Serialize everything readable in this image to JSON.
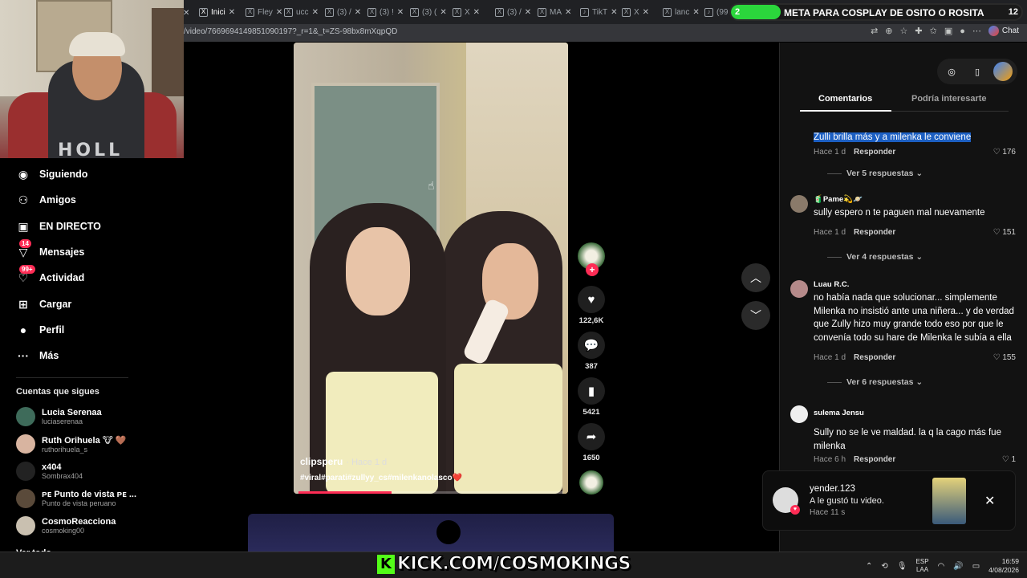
{
  "browser": {
    "tabs": [
      {
        "label": "Inici",
        "icon": "x-logo-icon",
        "active": true
      },
      {
        "label": "Fley",
        "icon": "x-logo-icon"
      },
      {
        "label": "ucc",
        "icon": "x-logo-icon"
      },
      {
        "label": "(3) /",
        "icon": "x-logo-icon"
      },
      {
        "label": "(3) !",
        "icon": "x-logo-icon"
      },
      {
        "label": "(3) (",
        "icon": "x-logo-icon"
      },
      {
        "label": "X",
        "icon": "x-logo-icon"
      },
      {
        "label": "(3) /",
        "icon": "x-logo-icon"
      },
      {
        "label": "MA",
        "icon": "x-logo-icon"
      },
      {
        "label": "TikT",
        "icon": "tiktok-icon"
      },
      {
        "label": "X",
        "icon": "x-logo-icon"
      },
      {
        "label": "lanc",
        "icon": "x-logo-icon"
      },
      {
        "label": "(99",
        "icon": "tiktok-icon"
      }
    ],
    "url": "/video/7669694149851090197?_r=1&_t=ZS-98bx8mXqpQD",
    "chat_label": "Chat"
  },
  "stream_goal": {
    "current": "2",
    "target": "12",
    "text": "META PARA COSPLAY DE OSITO O ROSITA",
    "progress": 0.17,
    "color": "#2bd63c"
  },
  "webcam": {
    "shirt_text": "HOLL"
  },
  "sidebar": {
    "nav": [
      {
        "label": "Siguiendo",
        "icon": "following-avatar-icon"
      },
      {
        "label": "Amigos",
        "icon": "friends-icon"
      },
      {
        "label": "EN DIRECTO",
        "icon": "live-icon"
      },
      {
        "label": "Mensajes",
        "icon": "messages-icon",
        "badge": "14"
      },
      {
        "label": "Actividad",
        "icon": "activity-icon",
        "badge": "99+"
      },
      {
        "label": "Cargar",
        "icon": "upload-icon"
      },
      {
        "label": "Perfil",
        "icon": "profile-icon"
      },
      {
        "label": "Más",
        "icon": "more-icon"
      }
    ],
    "following_title": "Cuentas que sigues",
    "following": [
      {
        "name": "Lucia Serenaa",
        "user": "luciaserenaa"
      },
      {
        "name": "Ruth Orihuela 🐮 🤎",
        "user": "ruthorihuela_s"
      },
      {
        "name": "x404",
        "user": "Sombrax404"
      },
      {
        "name": "ᴘᴇ Punto de vista ᴘᴇ ...",
        "user": "Punto de vista peruano"
      },
      {
        "name": "CosmoReacciona",
        "user": "cosmoking00"
      },
      {
        "name": "Ver todo",
        "user": ""
      }
    ]
  },
  "video": {
    "author": "clipsperu",
    "time": "· Hace 1 d",
    "tags": "#viral#parati#zullyy_cs#milenkanolasco❤️",
    "progress": 0.35,
    "actions": [
      {
        "icon": "heart-icon",
        "label": "122,6K"
      },
      {
        "icon": "comment-icon",
        "label": "387"
      },
      {
        "icon": "bookmark-icon",
        "label": "5421"
      },
      {
        "icon": "share-icon",
        "label": "1650"
      }
    ]
  },
  "comments_panel": {
    "tabs": [
      "Comentarios",
      "Podría interesarte"
    ],
    "reply_label": "Responder",
    "comments": [
      {
        "user": "",
        "text": "Zulli brilla más y a milenka le conviene",
        "time": "Hace 1 d",
        "likes": "176",
        "replies": "Ver 5 respuestas"
      },
      {
        "user": "🧃Pame💫🪐",
        "text": "sully espero n te paguen mal nuevamente",
        "time": "Hace 1 d",
        "likes": "151",
        "replies": "Ver 4 respuestas"
      },
      {
        "user": "Luau R.C.",
        "text": "no había nada que solucionar... simplemente Milenka no insistió ante una niñera... y de verdad que Zully hizo muy grande todo eso por que le convenía todo su hare de Milenka le subía a ella",
        "time": "Hace 1 d",
        "likes": "155",
        "replies": "Ver 6 respuestas"
      },
      {
        "user": "sulema Jensu",
        "text": "Sully no se le ve maldad. la q la cago más fue milenka",
        "time": "Hace 6 h",
        "likes": "1",
        "replies": ""
      }
    ]
  },
  "notification": {
    "user": "yender.123",
    "text": "A le gustó tu video.",
    "time": "Hace 11 s"
  },
  "taskbar": {
    "kick_text": "KICK.COM/COSMOKINGS",
    "kick_color": "#53fc18",
    "lang_top": "ESP",
    "lang_bottom": "LAA",
    "time": "16:59",
    "date": "4/08/2026"
  }
}
